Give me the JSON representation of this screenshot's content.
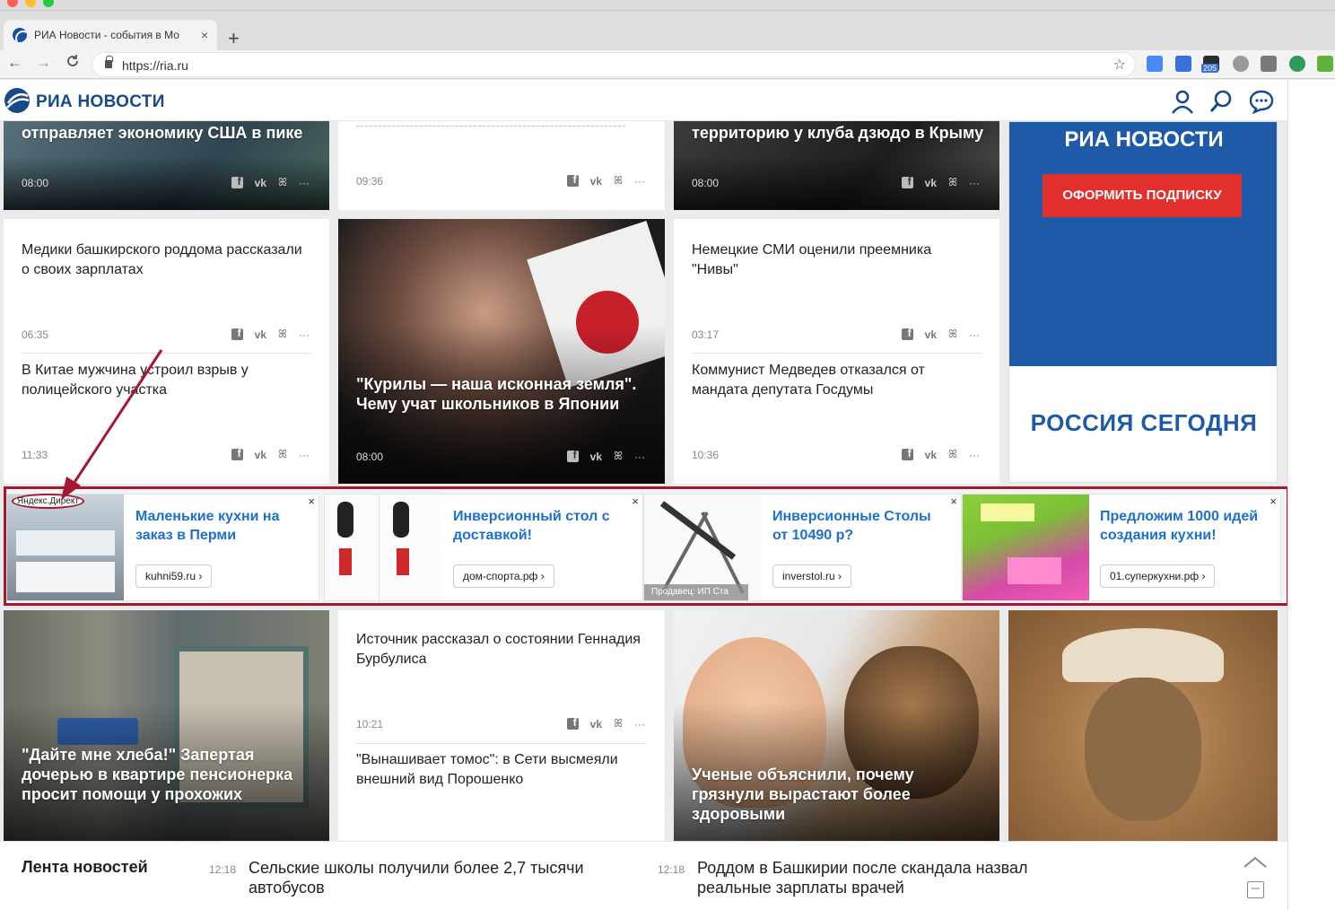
{
  "browser": {
    "tab_title": "РИА Новости - события в Мо",
    "tab_close": "×",
    "new_tab": "+",
    "url": "https://ria.ru",
    "back": "←",
    "forward": "→",
    "reload": "C",
    "bookmark_star": "☆",
    "ext_badge": "205"
  },
  "site": {
    "logo": "РИА НОВОСТИ"
  },
  "row1": [
    {
      "title": "отправляет экономику США в пике",
      "time": "08:00"
    },
    {
      "title": "",
      "time": "09:36"
    },
    {
      "title": "территорию у клуба дзюдо в Крыму",
      "time": "08:00"
    }
  ],
  "promo": {
    "brand": "РИА НОВОСТИ",
    "button": "ОФОРМИТЬ ПОДПИСКУ",
    "sponsor": "РОССИЯ СЕГОДНЯ"
  },
  "row2": {
    "left": [
      {
        "title": "Медики башкирского роддома рассказали о своих зарплатах",
        "time": "06:35"
      },
      {
        "title": "В Китае мужчина устроил взрыв у полицейского участка",
        "time": "11:33"
      }
    ],
    "center": {
      "title": "\"Курилы — наша исконная земля\". Чему учат школьников в Японии",
      "time": "08:00"
    },
    "right": [
      {
        "title": "Немецкие СМИ оценили преемника \"Нивы\"",
        "time": "03:17"
      },
      {
        "title": "Коммунист Медведев отказался от мандата депутата Госдумы",
        "time": "10:36"
      }
    ]
  },
  "share_labels": {
    "vk": "vk",
    "ok": "ꕤ",
    "more": "···"
  },
  "ads": {
    "label": "Яндекс.Директ",
    "close": "×",
    "items": [
      {
        "title": "Маленькие кухни на заказ в Перми",
        "link": "kuhni59.ru ›"
      },
      {
        "title": "Инверсионный стол с доставкой!",
        "link": "дом-спорта.рф ›"
      },
      {
        "title": "Инверсионные Столы от 10490 р?",
        "link": "inverstol.ru ›",
        "seller": "Продавец: ИП Ста"
      },
      {
        "title": "Предложим 1000 идей создания кухни!",
        "link": "01.суперкухни.рф ›"
      }
    ]
  },
  "row3": {
    "left": {
      "title": "\"Дайте мне хлеба!\" Запертая дочерью в квартире пенсионерка просит помощи у прохожих"
    },
    "center": [
      {
        "title": "Источник рассказал о состоянии Геннадия Бурбулиса",
        "time": "10:21"
      },
      {
        "title": "\"Вынашивает томос\": в Сети высмеяли внешний вид Порошенко"
      }
    ],
    "right": {
      "title": "Ученые объяснили, почему грязнули вырастают более здоровыми"
    }
  },
  "ticker": {
    "title": "Лента новостей",
    "items": [
      {
        "time": "12:18",
        "text": "Сельские школы получили более 2,7 тысячи автобусов"
      },
      {
        "time": "12:18",
        "text": "Роддом в Башкирии после скандала назвал реальные зарплаты врачей"
      }
    ],
    "collapse": "–"
  },
  "colors": {
    "brand_blue": "#174a8b",
    "promo_blue": "#1e5aa8",
    "promo_red": "#e3302f",
    "ad_border": "#a6182f",
    "ad_link": "#1d6fd0"
  }
}
